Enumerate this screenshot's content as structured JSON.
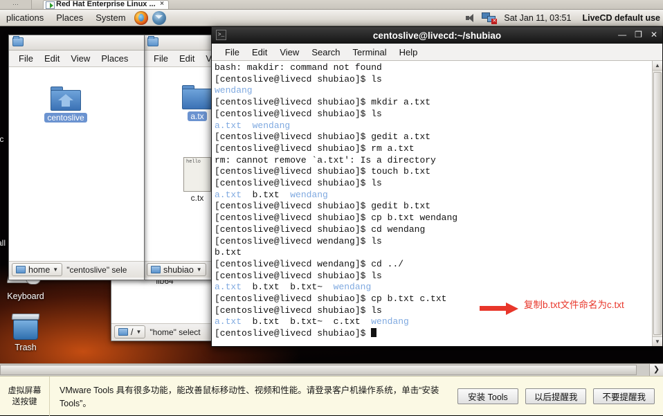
{
  "vmware": {
    "tab_title": "Red Hat Enterprise Linux ...",
    "tab_close": "×",
    "tools_left_line1": "虚拟屏幕",
    "tools_left_line2": "送按键",
    "tools_message": "VMware Tools 具有很多功能，能改善鼠标移动性、视频和性能。请登录客户机操作系统，单击“安装 Tools”。",
    "buttons": [
      {
        "label": "安装 Tools"
      },
      {
        "label": "以后提醒我"
      },
      {
        "label": "不要提醒我"
      }
    ]
  },
  "panel": {
    "menus": [
      "plications",
      "Places",
      "System"
    ],
    "firefox_icon": "firefox-icon",
    "thunderbird_icon": "thunderbird-icon",
    "volume_icon": "volume-icon",
    "network_icon": "network-disconnected-icon",
    "clock": "Sat Jan 11, 03:51",
    "user": "LiveCD default use"
  },
  "desktop": {
    "icons": [
      {
        "name": "keyboard",
        "label": "Keyboard"
      },
      {
        "name": "trash",
        "label": "Trash"
      }
    ],
    "partial_labels": [
      "tc",
      "all"
    ]
  },
  "window_home": {
    "title_icon": "folder-icon",
    "menus": [
      "File",
      "Edit",
      "View",
      "Places"
    ],
    "items": [
      {
        "name": "centoslive",
        "label": "centoslive",
        "selected": true,
        "icon": "home-folder-icon"
      }
    ],
    "path_button": "home",
    "status": "\"centoslive\" sele"
  },
  "window_shubiao": {
    "title_icon": "folder-icon",
    "menus": [
      "File",
      "Edit",
      "V"
    ],
    "items": [
      {
        "name": "a-txt",
        "label": "a.tx",
        "selected": true,
        "icon": "folder-icon"
      },
      {
        "name": "c-txt",
        "label": "c.tx",
        "selected": false,
        "icon": "text-file-icon",
        "preview": "hello"
      }
    ],
    "path_button": "shubiao"
  },
  "window_root": {
    "items": [
      {
        "name": "lib64",
        "label": "lib64"
      }
    ],
    "path_button": "/",
    "status": "\"home\" select"
  },
  "terminal": {
    "title": "centoslive@livecd:~/shubiao",
    "title_icon": "terminal-icon",
    "window_buttons": {
      "minimize": "—",
      "maximize": "❐",
      "close": "✕"
    },
    "menus": [
      "File",
      "Edit",
      "View",
      "Search",
      "Terminal",
      "Help"
    ],
    "prompt_shubiao": "[centoslive@livecd shubiao]$ ",
    "prompt_wendang": "[centoslive@livecd wendang]$ ",
    "lines": [
      {
        "type": "plain",
        "text": "bash: makdir: command not found"
      },
      {
        "type": "prompt",
        "prompt": "shubiao",
        "cmd": "ls"
      },
      {
        "type": "listing",
        "items": [
          {
            "t": "wendang",
            "dir": true
          }
        ]
      },
      {
        "type": "prompt",
        "prompt": "shubiao",
        "cmd": "mkdir a.txt"
      },
      {
        "type": "prompt",
        "prompt": "shubiao",
        "cmd": "ls"
      },
      {
        "type": "listing",
        "items": [
          {
            "t": "a.txt",
            "dir": true
          },
          {
            "t": "wendang",
            "dir": true
          }
        ]
      },
      {
        "type": "prompt",
        "prompt": "shubiao",
        "cmd": "gedit a.txt"
      },
      {
        "type": "prompt",
        "prompt": "shubiao",
        "cmd": "rm a.txt"
      },
      {
        "type": "plain",
        "text": "rm: cannot remove `a.txt': Is a directory"
      },
      {
        "type": "prompt",
        "prompt": "shubiao",
        "cmd": "touch b.txt"
      },
      {
        "type": "prompt",
        "prompt": "shubiao",
        "cmd": "ls"
      },
      {
        "type": "listing",
        "items": [
          {
            "t": "a.txt",
            "dir": true
          },
          {
            "t": "b.txt",
            "dir": false
          },
          {
            "t": "wendang",
            "dir": true
          }
        ]
      },
      {
        "type": "prompt",
        "prompt": "shubiao",
        "cmd": "gedit b.txt"
      },
      {
        "type": "prompt",
        "prompt": "shubiao",
        "cmd": "cp b.txt wendang"
      },
      {
        "type": "prompt",
        "prompt": "shubiao",
        "cmd": "cd wendang"
      },
      {
        "type": "prompt",
        "prompt": "wendang",
        "cmd": "ls"
      },
      {
        "type": "plain",
        "text": "b.txt"
      },
      {
        "type": "prompt",
        "prompt": "wendang",
        "cmd": "cd ../"
      },
      {
        "type": "prompt",
        "prompt": "shubiao",
        "cmd": "ls"
      },
      {
        "type": "listing",
        "items": [
          {
            "t": "a.txt",
            "dir": true
          },
          {
            "t": "b.txt",
            "dir": false
          },
          {
            "t": "b.txt~",
            "dir": false
          },
          {
            "t": "wendang",
            "dir": true
          }
        ]
      },
      {
        "type": "prompt",
        "prompt": "shubiao",
        "cmd": "cp b.txt c.txt",
        "highlight": true
      },
      {
        "type": "prompt",
        "prompt": "shubiao",
        "cmd": "ls"
      },
      {
        "type": "listing",
        "items": [
          {
            "t": "a.txt",
            "dir": true
          },
          {
            "t": "b.txt",
            "dir": false
          },
          {
            "t": "b.txt~",
            "dir": false
          },
          {
            "t": "c.txt",
            "dir": false
          },
          {
            "t": "wendang",
            "dir": true
          }
        ]
      },
      {
        "type": "prompt",
        "prompt": "shubiao",
        "cmd": "",
        "cursor": true
      }
    ]
  },
  "annotation": {
    "text": "复制b.txt文件命名为c.txt",
    "color": "#e8362a"
  },
  "colors": {
    "terminal_dir": "#7fa9e0",
    "selection_blue": "#6b93d0",
    "annotation_red": "#e8362a",
    "vmtools_bg": "#fbf9e4"
  }
}
